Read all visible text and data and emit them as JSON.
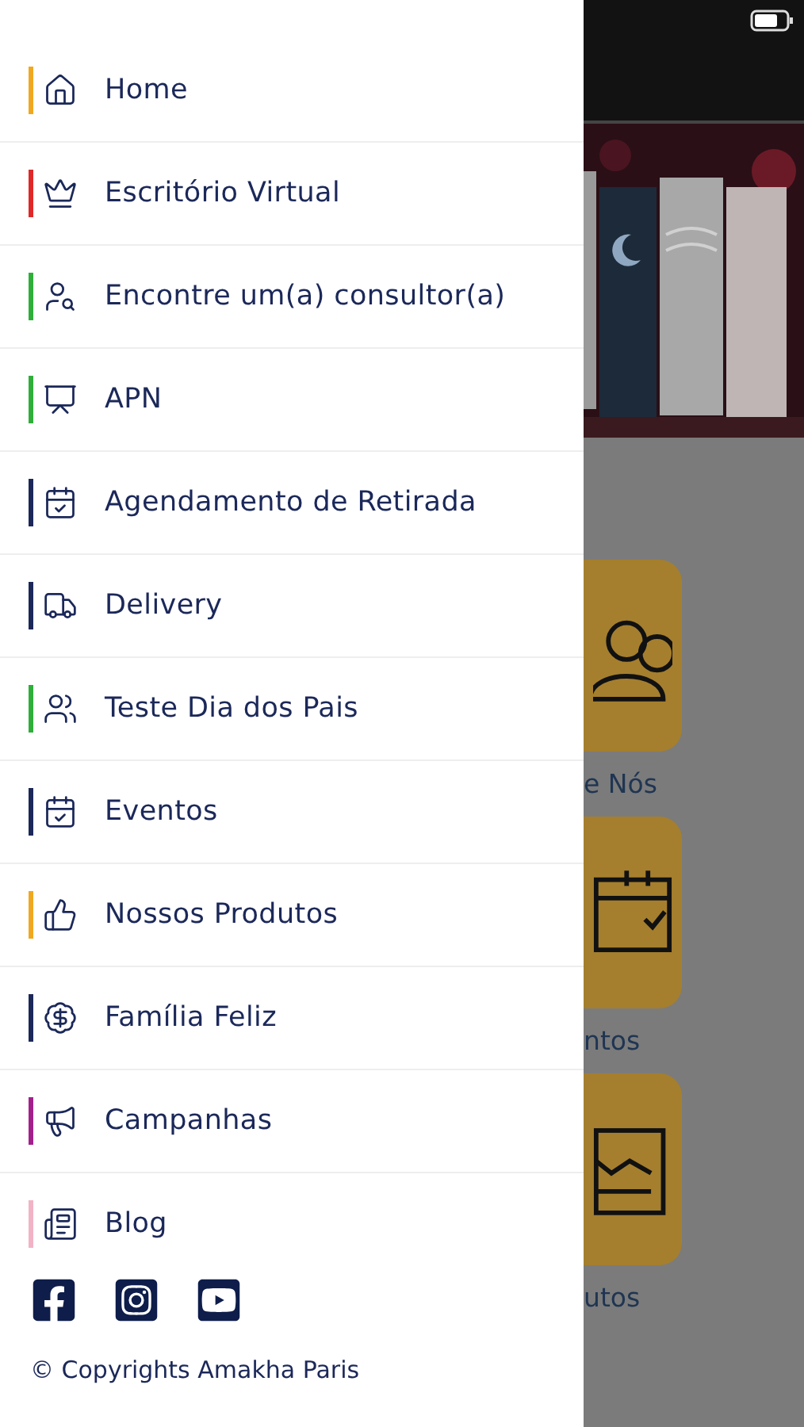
{
  "menu": [
    {
      "label": "Home",
      "color": "#f0a820"
    },
    {
      "label": "Escritório Virtual",
      "color": "#e02828"
    },
    {
      "label": "Encontre um(a) consultor(a)",
      "color": "#2fae3a"
    },
    {
      "label": "APN",
      "color": "#2fae3a"
    },
    {
      "label": "Agendamento de Retirada",
      "color": "#1b2859"
    },
    {
      "label": "Delivery",
      "color": "#1b2859"
    },
    {
      "label": "Teste Dia dos Pais",
      "color": "#2fae3a"
    },
    {
      "label": "Eventos",
      "color": "#1b2859"
    },
    {
      "label": "Nossos Produtos",
      "color": "#f0a820"
    },
    {
      "label": "Família Feliz",
      "color": "#1b2859"
    },
    {
      "label": "Campanhas",
      "color": "#a3208c"
    },
    {
      "label": "Blog",
      "color": "#f2b3c6"
    }
  ],
  "copyright": "© Copyrights Amakha Paris",
  "background_tiles": [
    {
      "label": "e Nós"
    },
    {
      "label": "ntos"
    },
    {
      "label": "utos"
    }
  ]
}
